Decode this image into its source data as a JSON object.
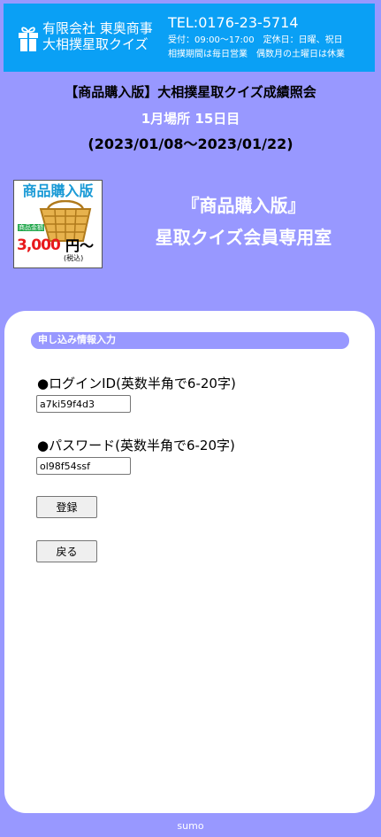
{
  "header": {
    "company_name": "有限会社 東奥商事",
    "company_sub": "大相撲星取クイズ",
    "tel": "TEL:0176-23-5714",
    "hours": "受付：09:00〜17:00　定休日：日曜、祝日",
    "period_note": "相撲期間は毎日営業　偶数月の土曜日は休業",
    "logo_icon": "gift-box-icon",
    "colors": {
      "background": "#0aa0f5",
      "text": "#ffffff"
    }
  },
  "event": {
    "title": "【商品購入版】大相撲星取クイズ成績照会",
    "day": "1月場所 15日目",
    "range": "(2023/01/08〜2023/01/22)"
  },
  "product_image": {
    "title": "商品購入版",
    "tag": "商品金額",
    "price": "3,000",
    "yen": "円〜",
    "tax": "(税込)",
    "icon": "shopping-basket-icon"
  },
  "room": {
    "title": "『商品購入版』",
    "subtitle": "星取クイズ会員専用室"
  },
  "form": {
    "section_label": "申し込み情報入力",
    "login_id": {
      "label": "●ログインID(英数半角で6-20字)",
      "value": "a7ki59f4d3"
    },
    "password": {
      "label": "●パスワード(英数半角で6-20字)",
      "value": "ol98f54ssf"
    },
    "register_label": "登録",
    "back_label": "戻る"
  },
  "footer": {
    "text": "sumo"
  },
  "colors": {
    "page_background": "#9898ff",
    "panel": "#ffffff",
    "section_bar": "#9898ff"
  }
}
